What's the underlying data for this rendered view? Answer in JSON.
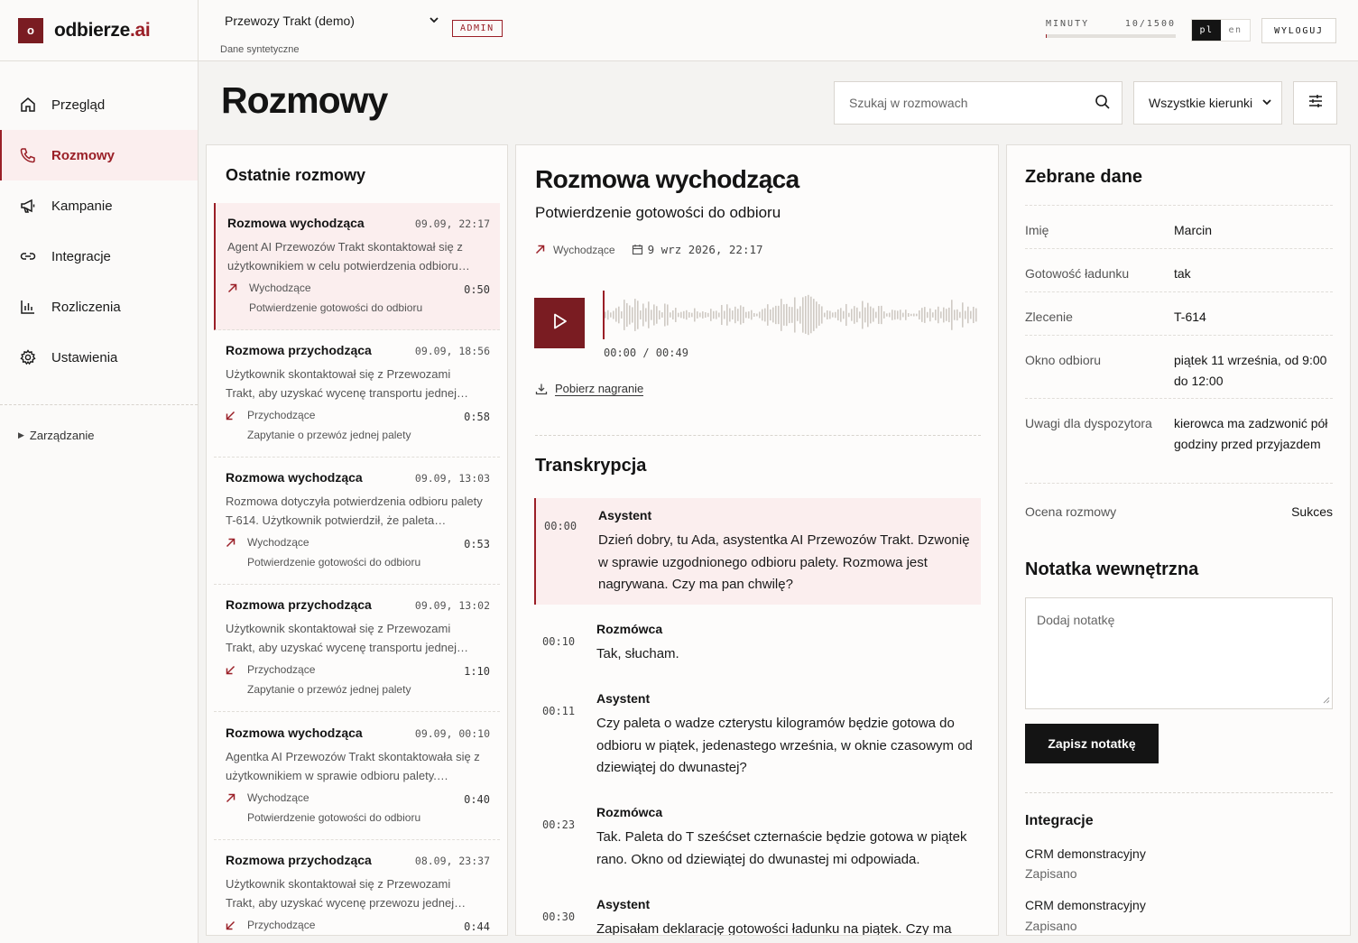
{
  "brand": {
    "badge": "o",
    "name": "odbierze",
    "tld": ".ai"
  },
  "nav": {
    "items": [
      {
        "label": "Przegląd",
        "icon": "home-icon"
      },
      {
        "label": "Rozmowy",
        "icon": "phone-icon"
      },
      {
        "label": "Kampanie",
        "icon": "megaphone-icon"
      },
      {
        "label": "Integracje",
        "icon": "link-icon"
      },
      {
        "label": "Rozliczenia",
        "icon": "bar-chart-icon"
      },
      {
        "label": "Ustawienia",
        "icon": "gear-icon"
      }
    ],
    "active_index": 1,
    "management": "Zarządzanie"
  },
  "topbar": {
    "org": "Przewozy Trakt (demo)",
    "org_sub": "Dane syntetyczne",
    "role": "ADMIN",
    "minutes_label": "MINUTY",
    "minutes_value": "10/1500",
    "minutes_used_fraction": 0.0067,
    "lang_active": "pl",
    "lang_other": "en",
    "logout": "WYLOGUJ"
  },
  "page": {
    "title": "Rozmowy",
    "search_placeholder": "Szukaj w rozmowach",
    "direction_filter": "Wszystkie kierunki"
  },
  "list": {
    "title": "Ostatnie rozmowy",
    "calls": [
      {
        "title": "Rozmowa wychodząca",
        "time": "09.09, 22:17",
        "desc": "Agent AI Przewozów Trakt skontaktował się z użytkownikiem w celu potwierdzenia odbioru…",
        "direction": "Wychodzące",
        "dir": "out",
        "duration": "0:50",
        "topic": "Potwierdzenie gotowości do odbioru"
      },
      {
        "title": "Rozmowa przychodząca",
        "time": "09.09, 18:56",
        "desc": "Użytkownik skontaktował się z Przewozami Trakt, aby uzyskać wycenę transportu jednej…",
        "direction": "Przychodzące",
        "dir": "in",
        "duration": "0:58",
        "topic": "Zapytanie o przewóz jednej palety"
      },
      {
        "title": "Rozmowa wychodząca",
        "time": "09.09, 13:03",
        "desc": "Rozmowa dotyczyła potwierdzenia odbioru palety T-614. Użytkownik potwierdził, że paleta…",
        "direction": "Wychodzące",
        "dir": "out",
        "duration": "0:53",
        "topic": "Potwierdzenie gotowości do odbioru"
      },
      {
        "title": "Rozmowa przychodząca",
        "time": "09.09, 13:02",
        "desc": "Użytkownik skontaktował się z Przewozami Trakt, aby uzyskać wycenę transportu jednej…",
        "direction": "Przychodzące",
        "dir": "in",
        "duration": "1:10",
        "topic": "Zapytanie o przewóz jednej palety"
      },
      {
        "title": "Rozmowa wychodząca",
        "time": "09.09, 00:10",
        "desc": "Agentka AI Przewozów Trakt skontaktowała się z użytkownikiem w sprawie odbioru palety.…",
        "direction": "Wychodzące",
        "dir": "out",
        "duration": "0:40",
        "topic": "Potwierdzenie gotowości do odbioru"
      },
      {
        "title": "Rozmowa przychodząca",
        "time": "08.09, 23:37",
        "desc": "Użytkownik skontaktował się z Przewozami Trakt, aby uzyskać wycenę przewozu jednej…",
        "direction": "Przychodzące",
        "dir": "in",
        "duration": "0:44",
        "topic": ""
      }
    ]
  },
  "detail": {
    "title": "Rozmowa wychodząca",
    "subtitle": "Potwierdzenie gotowości do odbioru",
    "direction": "Wychodzące",
    "date": "9 wrz 2026, 22:17",
    "player_time": "00:00 / 00:49",
    "download": "Pobierz nagranie",
    "transcript_title": "Transkrypcja",
    "transcript": [
      {
        "time": "00:00",
        "speaker": "Asystent",
        "text": "Dzień dobry, tu Ada, asystentka AI Przewozów Trakt. Dzwonię w sprawie uzgodnionego odbioru palety. Rozmowa jest nagrywana. Czy ma pan chwilę?"
      },
      {
        "time": "00:10",
        "speaker": "Rozmówca",
        "text": "Tak, słucham."
      },
      {
        "time": "00:11",
        "speaker": "Asystent",
        "text": "Czy paleta o wadze czterystu kilogramów będzie gotowa do odbioru w piątek, jedenastego września, w oknie czasowym od dziewiątej do dwunastej?"
      },
      {
        "time": "00:23",
        "speaker": "Rozmówca",
        "text": "Tak. Paleta do T sześćset czternaście będzie gotowa w piątek rano. Okno od dziewiątej do dwunastej mi odpowiada."
      },
      {
        "time": "00:30",
        "speaker": "Asystent",
        "text": "Zapisałam deklarację gotowości ładunku na piątek. Czy ma"
      }
    ]
  },
  "collected": {
    "title": "Zebrane dane",
    "fields": [
      {
        "key": "Imię",
        "value": "Marcin"
      },
      {
        "key": "Gotowość ładunku",
        "value": "tak"
      },
      {
        "key": "Zlecenie",
        "value": "T-614"
      },
      {
        "key": "Okno odbioru",
        "value": "piątek 11 września, od 9:00 do 12:00"
      },
      {
        "key": "Uwagi dla dyspozytora",
        "value": "kierowca ma zadzwonić pół godziny przed przyjazdem"
      },
      {
        "key": "Ocena rozmowy",
        "value": "Sukces"
      }
    ],
    "note_title": "Notatka wewnętrzna",
    "note_placeholder": "Dodaj notatkę",
    "save_label": "Zapisz notatkę",
    "integrations_title": "Integracje",
    "integrations": [
      {
        "name": "CRM demonstracyjny",
        "status": "Zapisano"
      },
      {
        "name": "CRM demonstracyjny",
        "status": "Zapisano"
      }
    ]
  },
  "colors": {
    "accent": "#7a1c22",
    "accent_light": "#fbeeee",
    "background": "#f4f3f1"
  }
}
